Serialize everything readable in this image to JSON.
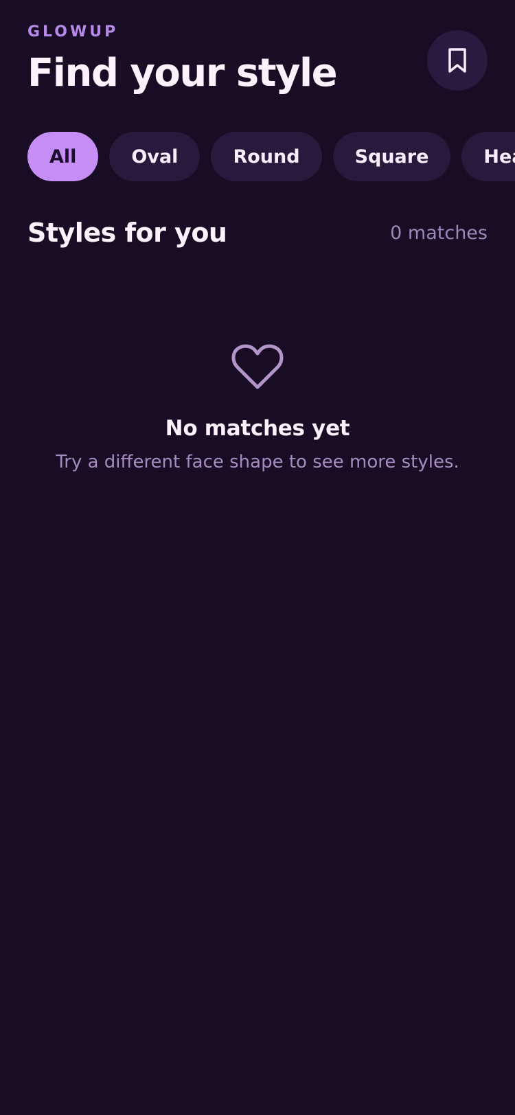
{
  "header": {
    "brand": "GLOWUP",
    "title": "Find your style",
    "bookmark_icon": "bookmark-icon"
  },
  "filters": {
    "chips": [
      {
        "label": "All",
        "active": true
      },
      {
        "label": "Oval",
        "active": false
      },
      {
        "label": "Round",
        "active": false
      },
      {
        "label": "Square",
        "active": false
      },
      {
        "label": "Heart",
        "active": false
      }
    ]
  },
  "section": {
    "title": "Styles for you",
    "count": "0 matches"
  },
  "empty_state": {
    "icon": "heart-icon",
    "title": "No matches yet",
    "subtitle": "Try a different face shape to see more styles."
  },
  "colors": {
    "background": "#190d26",
    "surface": "#281a3d",
    "accent": "#c68df5",
    "brand": "#b58ae8",
    "muted_text": "#9c87b6",
    "icon_muted": "#b296c9"
  }
}
